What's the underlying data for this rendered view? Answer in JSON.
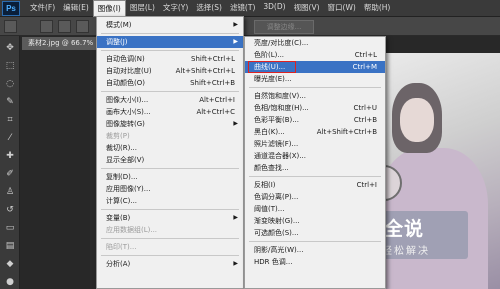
{
  "app_logo": "Ps",
  "menubar": {
    "items": [
      "文件(F)",
      "编辑(E)",
      "图像(I)",
      "图层(L)",
      "文字(Y)",
      "选择(S)",
      "滤镜(T)",
      "3D(D)",
      "视图(V)",
      "窗口(W)",
      "帮助(H)"
    ],
    "active_index": 2
  },
  "options_bar": {
    "adjust_edge": "调整边缘..."
  },
  "document_tab": "素材2.jpg @ 66.7%",
  "image_menu": {
    "items": [
      {
        "label": "模式(M)",
        "shortcut": "",
        "submenu": true
      },
      {
        "separator": true
      },
      {
        "label": "调整(J)",
        "shortcut": "",
        "submenu": true,
        "highlighted": true
      },
      {
        "separator": true
      },
      {
        "label": "自动色调(N)",
        "shortcut": "Shift+Ctrl+L"
      },
      {
        "label": "自动对比度(U)",
        "shortcut": "Alt+Shift+Ctrl+L"
      },
      {
        "label": "自动颜色(O)",
        "shortcut": "Shift+Ctrl+B"
      },
      {
        "separator": true
      },
      {
        "label": "图像大小(I)...",
        "shortcut": "Alt+Ctrl+I"
      },
      {
        "label": "画布大小(S)...",
        "shortcut": "Alt+Ctrl+C"
      },
      {
        "label": "图像旋转(G)",
        "shortcut": "",
        "submenu": true
      },
      {
        "label": "裁剪(P)",
        "shortcut": "",
        "disabled": true
      },
      {
        "label": "裁切(R)...",
        "shortcut": ""
      },
      {
        "label": "显示全部(V)",
        "shortcut": ""
      },
      {
        "separator": true
      },
      {
        "label": "复制(D)...",
        "shortcut": ""
      },
      {
        "label": "应用图像(Y)...",
        "shortcut": ""
      },
      {
        "label": "计算(C)...",
        "shortcut": ""
      },
      {
        "separator": true
      },
      {
        "label": "变量(B)",
        "shortcut": "",
        "submenu": true
      },
      {
        "label": "应用数据组(L)...",
        "shortcut": "",
        "disabled": true
      },
      {
        "separator": true
      },
      {
        "label": "陷印(T)...",
        "shortcut": "",
        "disabled": true
      },
      {
        "separator": true
      },
      {
        "label": "分析(A)",
        "shortcut": "",
        "submenu": true
      }
    ]
  },
  "adjust_submenu": {
    "items": [
      {
        "label": "亮度/对比度(C)...",
        "shortcut": ""
      },
      {
        "label": "色阶(L)...",
        "shortcut": "Ctrl+L"
      },
      {
        "label": "曲线(U)...",
        "shortcut": "Ctrl+M",
        "highlighted": true
      },
      {
        "label": "曝光度(E)...",
        "shortcut": ""
      },
      {
        "separator": true
      },
      {
        "label": "自然饱和度(V)...",
        "shortcut": ""
      },
      {
        "label": "色相/饱和度(H)...",
        "shortcut": "Ctrl+U"
      },
      {
        "label": "色彩平衡(B)...",
        "shortcut": "Ctrl+B"
      },
      {
        "label": "黑白(K)...",
        "shortcut": "Alt+Shift+Ctrl+B"
      },
      {
        "label": "照片滤镜(F)...",
        "shortcut": ""
      },
      {
        "label": "通道混合器(X)...",
        "shortcut": ""
      },
      {
        "label": "颜色查找...",
        "shortcut": ""
      },
      {
        "separator": true
      },
      {
        "label": "反相(I)",
        "shortcut": "Ctrl+I"
      },
      {
        "label": "色调分离(P)...",
        "shortcut": ""
      },
      {
        "label": "阈值(T)...",
        "shortcut": ""
      },
      {
        "label": "渐变映射(G)...",
        "shortcut": ""
      },
      {
        "label": "可选颜色(S)...",
        "shortcut": ""
      },
      {
        "separator": true
      },
      {
        "label": "阴影/高光(W)...",
        "shortcut": ""
      },
      {
        "label": "HDR 色调...",
        "shortcut": ""
      }
    ]
  },
  "watermark": {
    "title": "百科全说",
    "subtitle": "助你轻松解决"
  }
}
